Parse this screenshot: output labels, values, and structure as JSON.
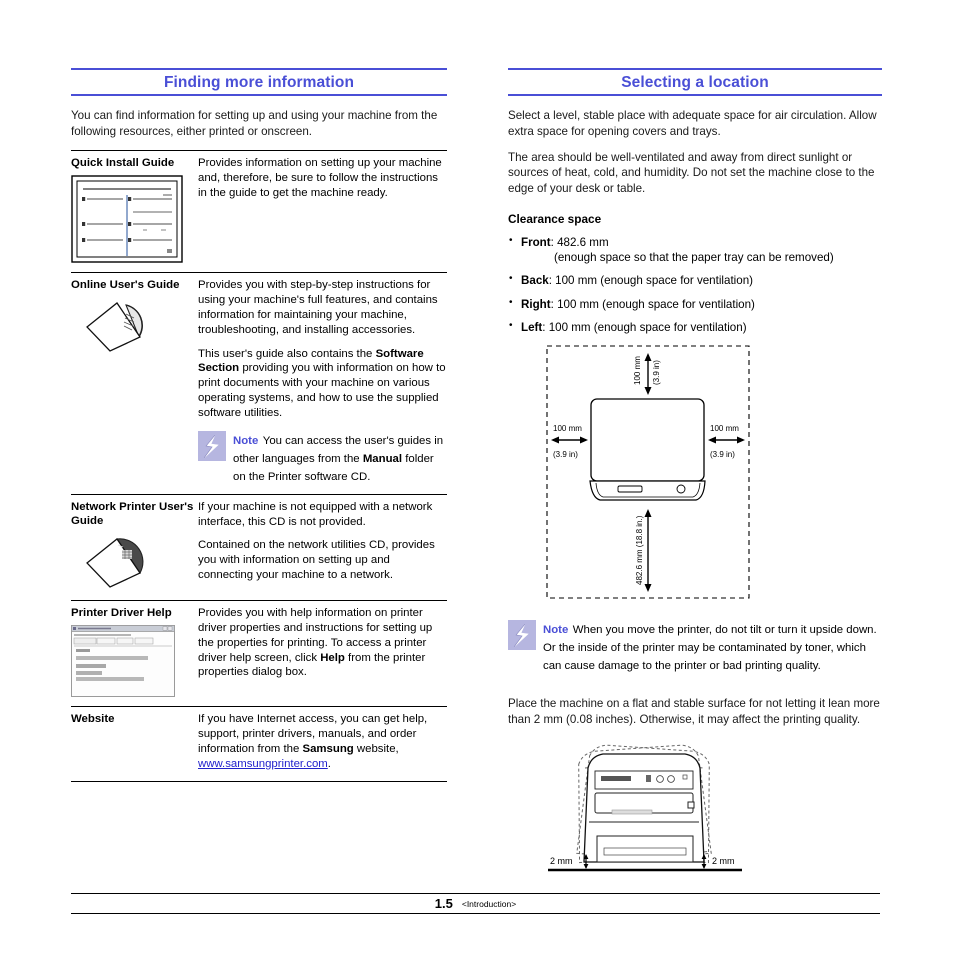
{
  "document": {
    "page_number": "1.5",
    "section_marker": "<Introduction>"
  },
  "theme": {
    "accent": "#4a4fd6",
    "link": "#2222cc",
    "note_icon_bg": "#b6b6e0",
    "text": "#1a1a1a"
  },
  "left_column": {
    "heading": "Finding more information",
    "intro": "You can find information for setting up and using your machine from the following resources, either printed or onscreen.",
    "resources": [
      {
        "name": "Quick Install Guide",
        "icon": "quick-install-guide-booklet",
        "paragraphs": [
          "Provides information on setting up your machine and, therefore, be sure to follow the instructions in the guide to get the machine ready."
        ]
      },
      {
        "name": "Online User's Guide",
        "icon": "cd-disc",
        "paragraphs": [
          "Provides you with step-by-step instructions for using your machine's full features, and contains information for maintaining your machine, troubleshooting, and installing accessories."
        ],
        "rich_paragraph": {
          "prefix": "This user's guide also contains the ",
          "bold1": "Software Section",
          "suffix": " providing you with information on how to print documents with your machine on various operating systems, and how to use the supplied software utilities."
        },
        "note": {
          "title": "Note",
          "prefix": "You can access the user's guides in other languages from the ",
          "bold": "Manual",
          "suffix": " folder on the Printer software CD."
        }
      },
      {
        "name": "Network Printer User's Guide",
        "icon": "cd-disc-dark",
        "paragraphs": [
          "If your  machine is not equipped with a network interface,  this CD is not provided.",
          "Contained on the network utilities CD, provides you with information on setting up and connecting your machine to a network."
        ]
      },
      {
        "name": "Printer Driver Help",
        "icon": "driver-help-window",
        "rich_paragraph": {
          "prefix": "Provides you with help information on printer driver properties and instructions for setting up the properties for printing. To access a printer driver help screen, click ",
          "bold1": "Help",
          "suffix": " from the printer properties dialog box."
        }
      },
      {
        "name": "Website",
        "icon": "none",
        "rich_paragraph": {
          "prefix": "If you have Internet access, you can get help, support, printer drivers, manuals, and order information from the ",
          "bold1": "Samsung",
          "mid": " website, ",
          "link": "www.samsungprinter.com",
          "suffix": "."
        }
      }
    ]
  },
  "right_column": {
    "heading": "Selecting a location",
    "paragraphs": [
      "Select a level, stable place with adequate space for air circulation. Allow extra space for opening covers and trays.",
      "The area should be well-ventilated and away from direct sunlight or sources of heat, cold, and humidity. Do not set the machine close to the edge of your desk or table."
    ],
    "clearance_heading": "Clearance space",
    "clearance_items": [
      {
        "label": "Front",
        "value": ": 482.6 mm",
        "sub": "(enough space so that the paper tray can be removed)"
      },
      {
        "label": "Back",
        "value": ": 100 mm (enough space for ventilation)",
        "sub": ""
      },
      {
        "label": "Right",
        "value": ": 100 mm (enough space for ventilation)",
        "sub": ""
      },
      {
        "label": "Left",
        "value": ": 100 mm (enough space for ventilation)",
        "sub": ""
      }
    ],
    "clearance_figure": {
      "top_mm": "100 mm",
      "top_in": "(3.9 in)",
      "left_mm": "100 mm",
      "left_in": "(3.9 in)",
      "right_mm": "100 mm",
      "right_in": "(3.9 in)",
      "front_label": "482.6 mm (18.8 in.)"
    },
    "note": {
      "title": "Note",
      "text": "When you move the printer, do not tilt or turn it upside down. Or the inside of the printer may be contaminated by toner, which can cause damage to the printer or bad printing quality."
    },
    "closing_paragraph": "Place the machine on a flat and stable surface for not letting it lean more than 2 mm (0.08 inches). Otherwise, it may affect the printing quality.",
    "lean_figure": {
      "left_label": "2 mm",
      "right_label": "2 mm"
    }
  }
}
